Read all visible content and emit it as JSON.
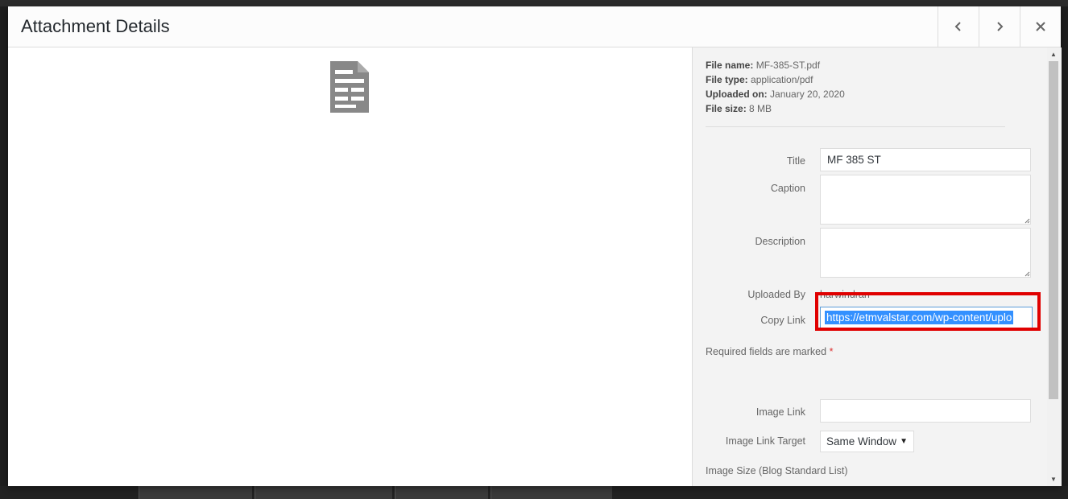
{
  "modal": {
    "title": "Attachment Details",
    "prev_icon": "chevron-left-icon",
    "next_icon": "chevron-right-icon",
    "close_icon": "close-icon"
  },
  "preview": {
    "icon": "document-icon"
  },
  "file_info": {
    "name_label": "File name:",
    "name_value": "MF-385-ST.pdf",
    "type_label": "File type:",
    "type_value": "application/pdf",
    "uploaded_label": "Uploaded on:",
    "uploaded_value": "January 20, 2020",
    "size_label": "File size:",
    "size_value": "8 MB"
  },
  "form": {
    "title_label": "Title",
    "title_value": "MF 385 ST",
    "caption_label": "Caption",
    "caption_value": "",
    "description_label": "Description",
    "description_value": "",
    "uploaded_by_label": "Uploaded By",
    "uploaded_by_value": "harwindran",
    "copy_link_label": "Copy Link",
    "copy_link_value": "https://etmvalstar.com/wp-content/uplo",
    "required_text": "Required fields are marked",
    "required_star": "*",
    "image_link_label": "Image Link",
    "image_link_value": "",
    "image_link_target_label": "Image Link Target",
    "image_link_target_value": "Same Window",
    "image_size_label": "Image Size (Blog Standard List)"
  },
  "colors": {
    "highlight": "#e00000",
    "selection": "#3390ff"
  }
}
